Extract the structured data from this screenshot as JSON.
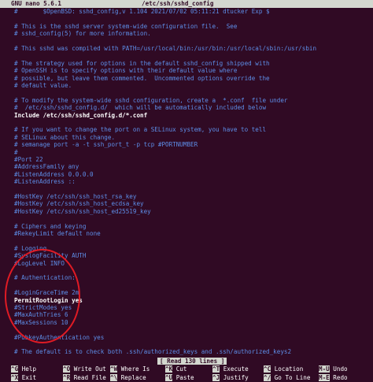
{
  "titlebar": {
    "version": "GNU nano 5.6.1",
    "filename": "/etc/ssh/sshd_config"
  },
  "lines": [
    "#       $OpenBSD: sshd_config,v 1.104 2021/07/02 05:11:21 dtucker Exp $",
    "",
    "# This is the sshd server system-wide configuration file.  See",
    "# sshd_config(5) for more information.",
    "",
    "# This sshd was compiled with PATH=/usr/local/bin:/usr/bin:/usr/local/sbin:/usr/sbin",
    "",
    "# The strategy used for options in the default sshd_config shipped with",
    "# OpenSSH is to specify options with their default value where",
    "# possible, but leave them commented.  Uncommented options override the",
    "# default value.",
    "",
    "# To modify the system-wide sshd configuration, create a  *.conf  file under",
    "#  /etc/ssh/sshd_config.d/  which will be automatically included below",
    "Include /etc/ssh/sshd_config.d/*.conf",
    "",
    "# If you want to change the port on a SELinux system, you have to tell",
    "# SELinux about this change.",
    "# semanage port -a -t ssh_port_t -p tcp #PORTNUMBER",
    "#",
    "#Port 22",
    "#AddressFamily any",
    "#ListenAddress 0.0.0.0",
    "#ListenAddress ::",
    "",
    "#HostKey /etc/ssh/ssh_host_rsa_key",
    "#HostKey /etc/ssh/ssh_host_ecdsa_key",
    "#HostKey /etc/ssh/ssh_host_ed25519_key",
    "",
    "# Ciphers and keying",
    "#RekeyLimit default none",
    "",
    "# Logging",
    "#SyslogFacility AUTH",
    "#LogLevel INFO",
    "",
    "# Authentication:",
    "",
    "#LoginGraceTime 2m",
    "PermitRootLogin yes",
    "#StrictModes yes",
    "#MaxAuthTries 6",
    "#MaxSessions 10",
    "",
    "#PubkeyAuthentication yes",
    "",
    "# The default is to check both .ssh/authorized_keys and .ssh/authorized_keys2"
  ],
  "status": "[ Read 130 lines ]",
  "shortcuts": [
    {
      "key": "^G",
      "label": "Help"
    },
    {
      "key": "^O",
      "label": "Write Out"
    },
    {
      "key": "^W",
      "label": "Where Is"
    },
    {
      "key": "^K",
      "label": "Cut"
    },
    {
      "key": "^T",
      "label": "Execute"
    },
    {
      "key": "^C",
      "label": "Location"
    },
    {
      "key": "M-U",
      "label": "Undo"
    },
    {
      "key": "^X",
      "label": "Exit"
    },
    {
      "key": "^R",
      "label": "Read File"
    },
    {
      "key": "^\\",
      "label": "Replace"
    },
    {
      "key": "^U",
      "label": "Paste"
    },
    {
      "key": "^J",
      "label": "Justify"
    },
    {
      "key": "^/",
      "label": "Go To Line"
    },
    {
      "key": "M-E",
      "label": "Redo"
    }
  ],
  "colors": {
    "background": "#300a24",
    "comment": "#5d8ee8",
    "active_text": "#ffffff",
    "bar": "#d3d7cf",
    "annotation": "#e01b24"
  }
}
